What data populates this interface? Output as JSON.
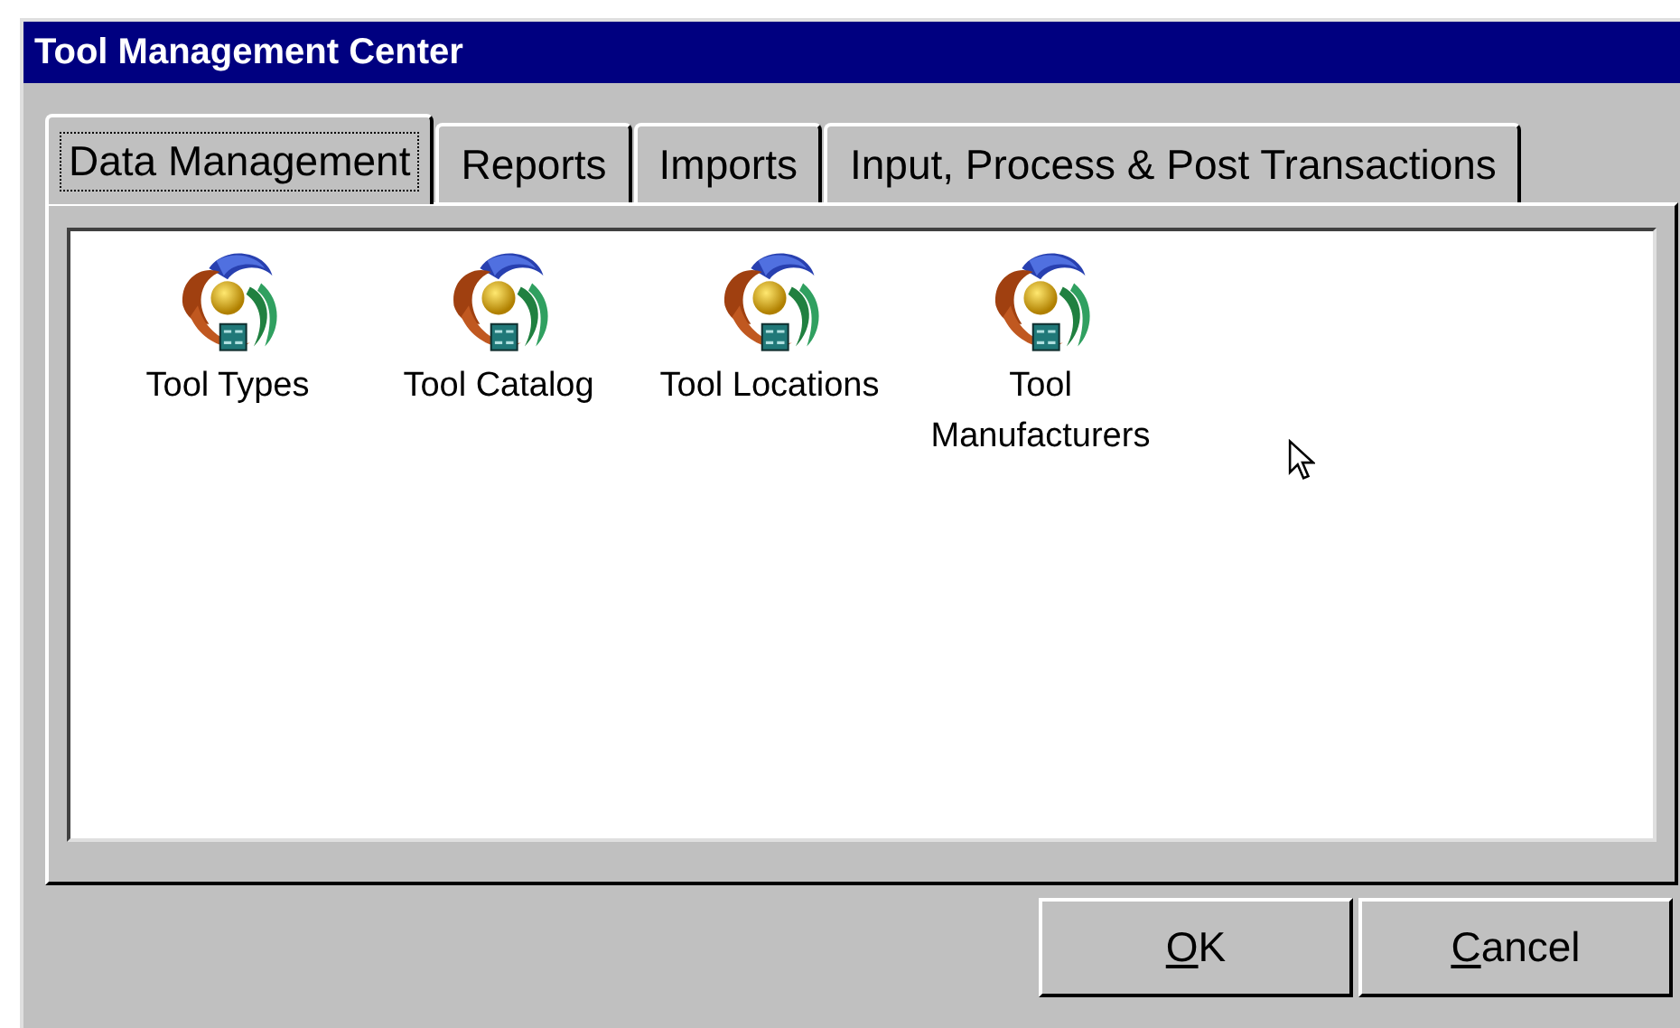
{
  "window": {
    "title": "Tool Management Center"
  },
  "tabs": [
    {
      "label": "Data Management",
      "selected": true
    },
    {
      "label": "Reports",
      "selected": false
    },
    {
      "label": "Imports",
      "selected": false
    },
    {
      "label": "Input, Process & Post Transactions",
      "selected": false
    }
  ],
  "items": [
    {
      "label": "Tool Types"
    },
    {
      "label": "Tool Catalog"
    },
    {
      "label": "Tool Locations"
    },
    {
      "label": "Tool Manufacturers"
    }
  ],
  "buttons": [
    {
      "access_key": "O",
      "rest": "K"
    },
    {
      "access_key": "C",
      "rest": "ancel"
    }
  ]
}
